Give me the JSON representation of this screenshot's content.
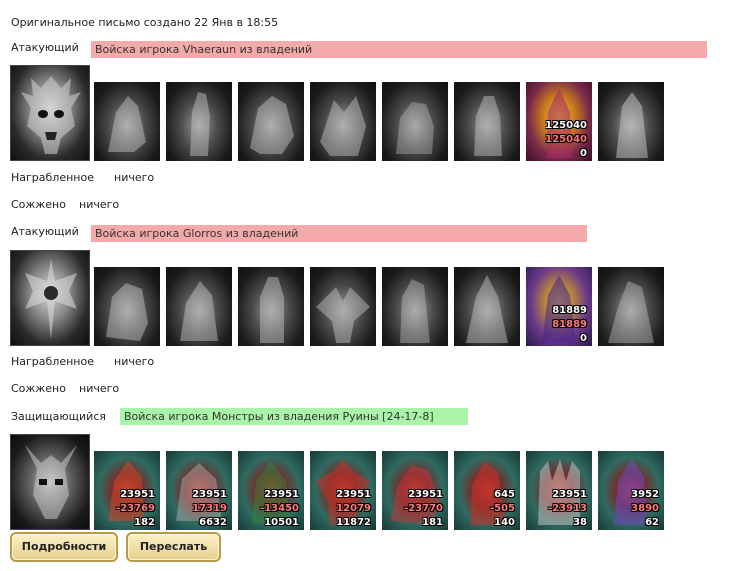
{
  "header": {
    "created": "Оригинальное письмо создано 22 Янв в 18:55"
  },
  "sections": [
    {
      "role_label": "Атакующий",
      "bar_text": "Войска игрока Vhaeraun из владений",
      "bar_color": "#f4aaaa",
      "units": [
        {
          "theme": "gray",
          "counts": []
        },
        {
          "theme": "gray",
          "counts": []
        },
        {
          "theme": "gray",
          "counts": []
        },
        {
          "theme": "gray",
          "counts": []
        },
        {
          "theme": "gray",
          "counts": []
        },
        {
          "theme": "gray",
          "counts": []
        },
        {
          "theme": "gold",
          "counts": [
            "125040",
            "125040",
            "0"
          ]
        },
        {
          "theme": "gray",
          "counts": []
        }
      ],
      "loot_label": "Награбленное",
      "loot_value": "ничего",
      "burned_label": "Сожжено",
      "burned_value": "ничего"
    },
    {
      "role_label": "Атакующий",
      "bar_text": "Войска игрока Glorros из владений",
      "bar_color": "#f4aaaa",
      "units": [
        {
          "theme": "gray",
          "counts": []
        },
        {
          "theme": "gray",
          "counts": []
        },
        {
          "theme": "gray",
          "counts": []
        },
        {
          "theme": "gray",
          "counts": []
        },
        {
          "theme": "gray",
          "counts": []
        },
        {
          "theme": "gray",
          "counts": []
        },
        {
          "theme": "purple",
          "counts": [
            "81889",
            "81889",
            "0"
          ]
        },
        {
          "theme": "gray",
          "counts": []
        }
      ],
      "loot_label": "Награбленное",
      "loot_value": "ничего",
      "burned_label": "Сожжено",
      "burned_value": "ничего"
    },
    {
      "role_label": "Защищающийся",
      "bar_text": "Войска игрока Монстры из владения Руины [24-17-8]",
      "bar_color": "#aaf4aa",
      "units": [
        {
          "theme": "teal",
          "counts": [
            "23951",
            "-23769",
            "182"
          ]
        },
        {
          "theme": "teal",
          "counts": [
            "23951",
            "17319",
            "6632"
          ]
        },
        {
          "theme": "teal",
          "counts": [
            "23951",
            "-13450",
            "10501"
          ]
        },
        {
          "theme": "teal",
          "counts": [
            "23951",
            "12079",
            "11872"
          ]
        },
        {
          "theme": "teal",
          "counts": [
            "23951",
            "-23770",
            "181"
          ]
        },
        {
          "theme": "teal",
          "counts": [
            "645",
            "-505",
            "140"
          ]
        },
        {
          "theme": "teal",
          "counts": [
            "23951",
            "-23913",
            "38"
          ]
        },
        {
          "theme": "teal",
          "counts": [
            "3952",
            "3890",
            "62"
          ]
        }
      ]
    }
  ],
  "buttons": {
    "details": "Подробности",
    "forward": "Переслать"
  }
}
